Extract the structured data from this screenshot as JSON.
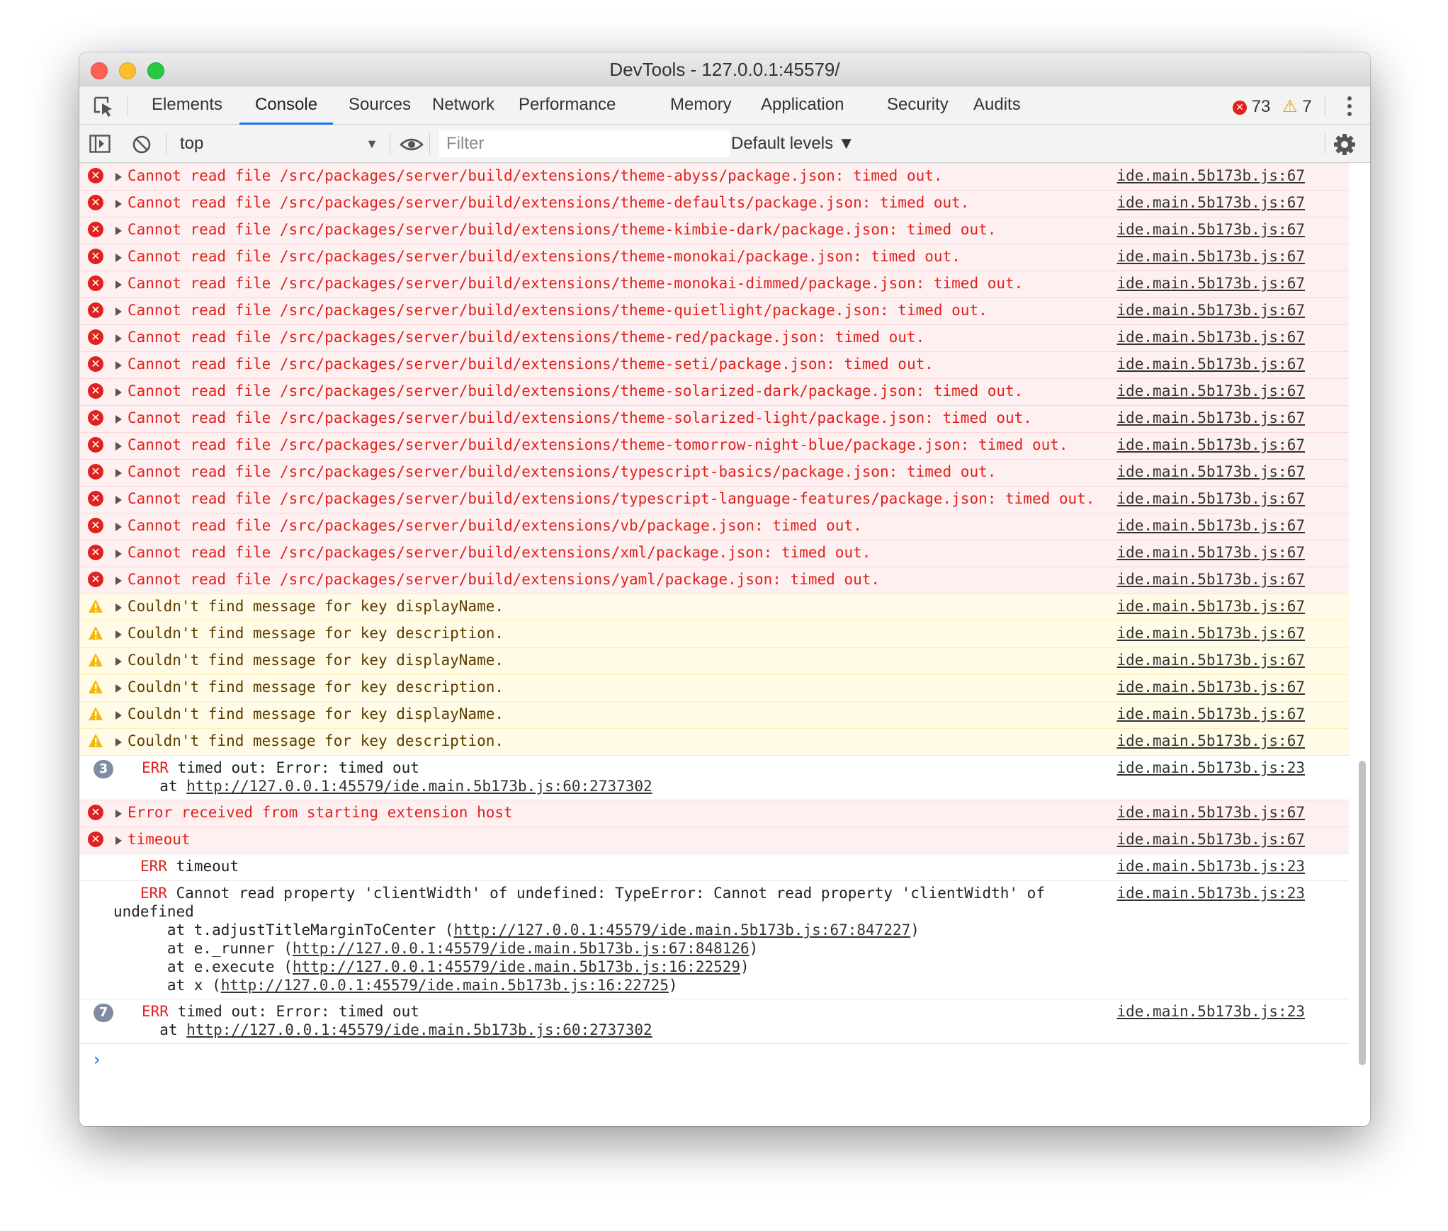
{
  "window": {
    "title": "DevTools - 127.0.0.1:45579/"
  },
  "tabs": [
    "Elements",
    "Console",
    "Sources",
    "Network",
    "Performance",
    "Memory",
    "Application",
    "Security",
    "Audits"
  ],
  "active_tab": "Console",
  "counts": {
    "errors": "73",
    "warnings": "7"
  },
  "toolbar": {
    "context": "top",
    "filter_placeholder": "Filter",
    "levels": "Default levels ▼"
  },
  "messages": [
    {
      "type": "error",
      "text": "Cannot read file /src/packages/server/build/extensions/theme-abyss/package.json: timed out.",
      "source": "ide.main.5b173b.js:67"
    },
    {
      "type": "error",
      "text": "Cannot read file /src/packages/server/build/extensions/theme-defaults/package.json: timed out.",
      "source": "ide.main.5b173b.js:67"
    },
    {
      "type": "error",
      "text": "Cannot read file /src/packages/server/build/extensions/theme-kimbie-dark/package.json: timed out.",
      "source": "ide.main.5b173b.js:67"
    },
    {
      "type": "error",
      "text": "Cannot read file /src/packages/server/build/extensions/theme-monokai/package.json: timed out.",
      "source": "ide.main.5b173b.js:67"
    },
    {
      "type": "error",
      "text": "Cannot read file /src/packages/server/build/extensions/theme-monokai-dimmed/package.json: timed out.",
      "source": "ide.main.5b173b.js:67"
    },
    {
      "type": "error",
      "text": "Cannot read file /src/packages/server/build/extensions/theme-quietlight/package.json: timed out.",
      "source": "ide.main.5b173b.js:67"
    },
    {
      "type": "error",
      "text": "Cannot read file /src/packages/server/build/extensions/theme-red/package.json: timed out.",
      "source": "ide.main.5b173b.js:67"
    },
    {
      "type": "error",
      "text": "Cannot read file /src/packages/server/build/extensions/theme-seti/package.json: timed out.",
      "source": "ide.main.5b173b.js:67"
    },
    {
      "type": "error",
      "text": "Cannot read file /src/packages/server/build/extensions/theme-solarized-dark/package.json: timed out.",
      "source": "ide.main.5b173b.js:67"
    },
    {
      "type": "error",
      "text": "Cannot read file /src/packages/server/build/extensions/theme-solarized-light/package.json: timed out.",
      "source": "ide.main.5b173b.js:67"
    },
    {
      "type": "error",
      "text": "Cannot read file /src/packages/server/build/extensions/theme-tomorrow-night-blue/package.json: timed out.",
      "source": "ide.main.5b173b.js:67"
    },
    {
      "type": "error",
      "text": "Cannot read file /src/packages/server/build/extensions/typescript-basics/package.json: timed out.",
      "source": "ide.main.5b173b.js:67"
    },
    {
      "type": "error",
      "text": "Cannot read file /src/packages/server/build/extensions/typescript-language-features/package.json: timed out.",
      "source": "ide.main.5b173b.js:67"
    },
    {
      "type": "error",
      "text": "Cannot read file /src/packages/server/build/extensions/vb/package.json: timed out.",
      "source": "ide.main.5b173b.js:67"
    },
    {
      "type": "error",
      "text": "Cannot read file /src/packages/server/build/extensions/xml/package.json: timed out.",
      "source": "ide.main.5b173b.js:67"
    },
    {
      "type": "error",
      "text": "Cannot read file /src/packages/server/build/extensions/yaml/package.json: timed out.",
      "source": "ide.main.5b173b.js:67"
    },
    {
      "type": "warning",
      "text": "Couldn't find message for key displayName.",
      "source": "ide.main.5b173b.js:67"
    },
    {
      "type": "warning",
      "text": "Couldn't find message for key description.",
      "source": "ide.main.5b173b.js:67"
    },
    {
      "type": "warning",
      "text": "Couldn't find message for key displayName.",
      "source": "ide.main.5b173b.js:67"
    },
    {
      "type": "warning",
      "text": "Couldn't find message for key description.",
      "source": "ide.main.5b173b.js:67"
    },
    {
      "type": "warning",
      "text": "Couldn't find message for key displayName.",
      "source": "ide.main.5b173b.js:67"
    },
    {
      "type": "warning",
      "text": "Couldn't find message for key description.",
      "source": "ide.main.5b173b.js:67"
    },
    {
      "type": "group",
      "count": "3",
      "tag": "ERR",
      "text": " timed out: Error: timed out",
      "lines": [
        {
          "prefix": "  at ",
          "link": "http://127.0.0.1:45579/ide.main.5b173b.js:60:2737302",
          "suffix": ""
        }
      ],
      "source": "ide.main.5b173b.js:23"
    },
    {
      "type": "error",
      "text": "Error received from starting extension host",
      "source": "ide.main.5b173b.js:67"
    },
    {
      "type": "error",
      "text": "timeout",
      "source": "ide.main.5b173b.js:67"
    },
    {
      "type": "plain",
      "tag": "ERR",
      "text": " timeout",
      "lines": [],
      "source": "ide.main.5b173b.js:23"
    },
    {
      "type": "plain",
      "tag": "ERR",
      "text": " Cannot read property 'clientWidth' of undefined: TypeError: Cannot read property 'clientWidth' of undefined",
      "lines": [
        {
          "prefix": "      at t.adjustTitleMarginToCenter (",
          "link": "http://127.0.0.1:45579/ide.main.5b173b.js:67:847227",
          "suffix": ")"
        },
        {
          "prefix": "      at e._runner (",
          "link": "http://127.0.0.1:45579/ide.main.5b173b.js:67:848126",
          "suffix": ")"
        },
        {
          "prefix": "      at e.execute (",
          "link": "http://127.0.0.1:45579/ide.main.5b173b.js:16:22529",
          "suffix": ")"
        },
        {
          "prefix": "      at x (",
          "link": "http://127.0.0.1:45579/ide.main.5b173b.js:16:22725",
          "suffix": ")"
        }
      ],
      "source": "ide.main.5b173b.js:23"
    },
    {
      "type": "group",
      "count": "7",
      "tag": "ERR",
      "text": " timed out: Error: timed out",
      "lines": [
        {
          "prefix": "  at ",
          "link": "http://127.0.0.1:45579/ide.main.5b173b.js:60:2737302",
          "suffix": ""
        }
      ],
      "source": "ide.main.5b173b.js:23"
    }
  ],
  "prompt": "›",
  "colors": {
    "error": "#e0211d",
    "warning_bg": "#fffbe6",
    "error_bg": "#fef0f0",
    "accent": "#1a73e8"
  },
  "icons": [
    "inspect-icon",
    "sidebar-toggle-icon",
    "clear-console-icon",
    "eye-icon",
    "gear-icon",
    "error-icon",
    "warning-icon",
    "kebab-icon"
  ]
}
